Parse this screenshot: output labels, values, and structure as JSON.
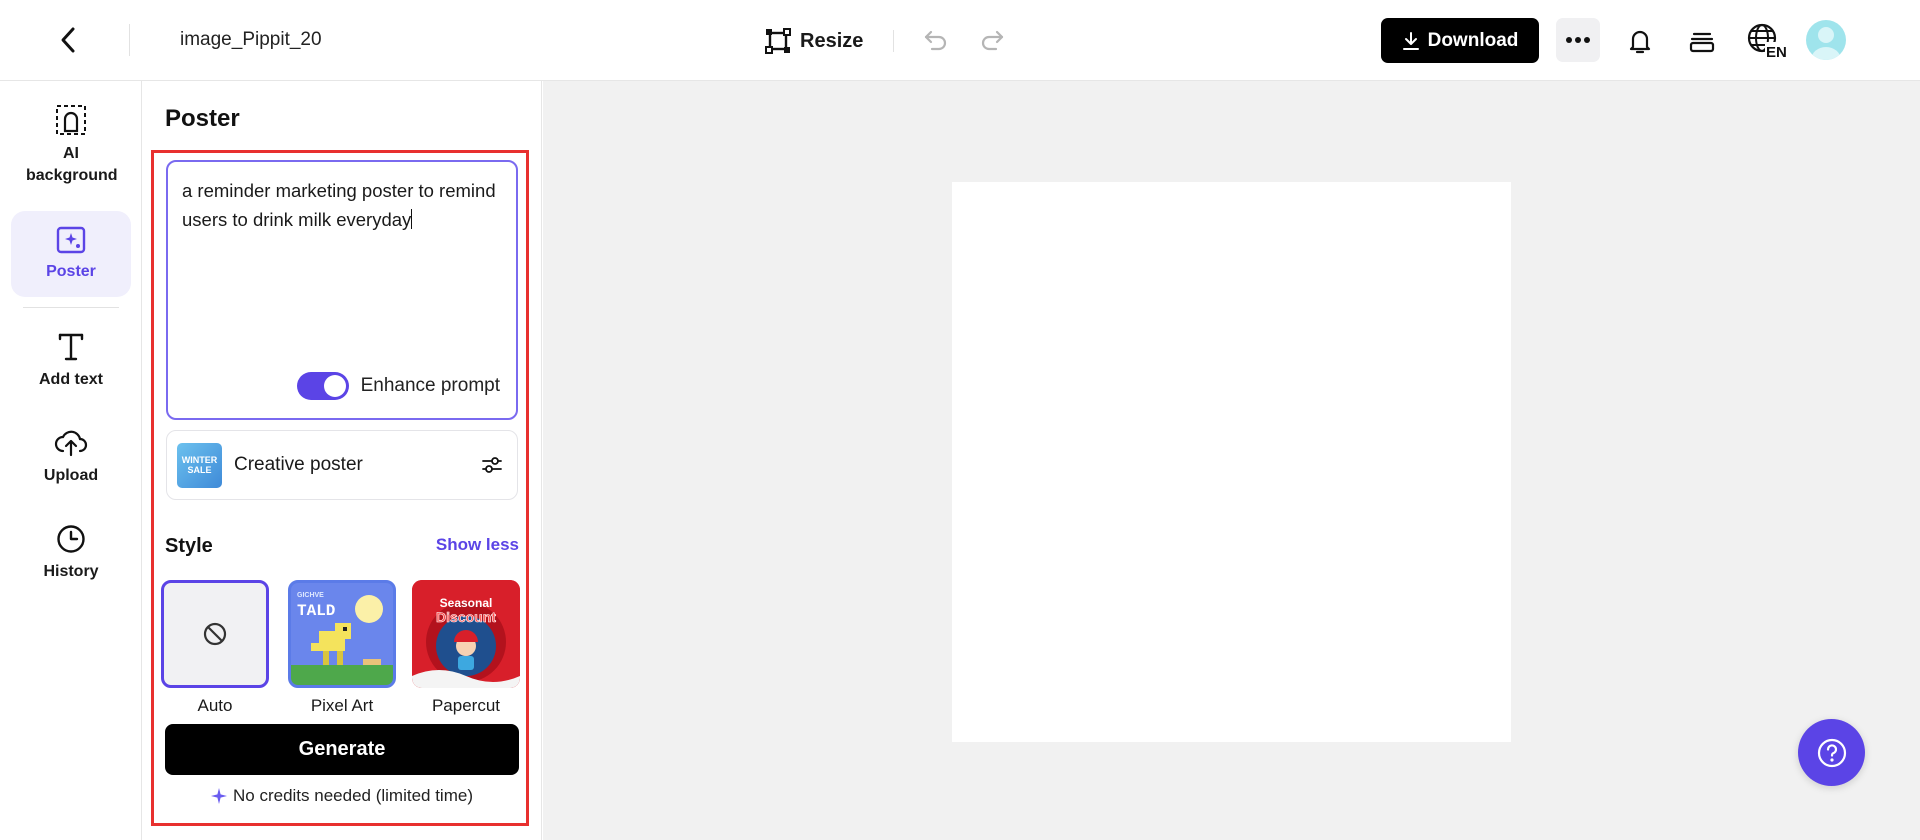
{
  "header": {
    "filename": "image_Pippit_20",
    "resize_label": "Resize",
    "download_label": "Download",
    "language_badge": "EN"
  },
  "rail": {
    "items": [
      {
        "label": "AI background",
        "icon": "ai-background-icon"
      },
      {
        "label": "Poster",
        "icon": "poster-icon",
        "active": true
      },
      {
        "label": "Add text",
        "icon": "text-icon"
      },
      {
        "label": "Upload",
        "icon": "upload-icon"
      },
      {
        "label": "History",
        "icon": "history-icon"
      }
    ]
  },
  "panel": {
    "title": "Poster",
    "prompt_value": "a reminder marketing poster to remind users to drink milk everyday",
    "enhance_label": "Enhance prompt",
    "enhance_on": true,
    "template_label": "Creative poster",
    "template_thumb_text": "WINTER SALE",
    "style_label": "Style",
    "show_less_label": "Show less",
    "styles": [
      {
        "label": "Auto",
        "selected": true
      },
      {
        "label": "Pixel Art",
        "thumb_text": "TALD",
        "thumb_small_text": "GICHVE"
      },
      {
        "label": "Papercut",
        "thumb_text": "Discount",
        "thumb_small_text": "Seasonal"
      }
    ],
    "generate_label": "Generate",
    "credits_note": "No credits needed (limited time)"
  },
  "colors": {
    "accent": "#5b44e6",
    "highlight_box": "#e8302f",
    "workspace_bg": "#f1f1f1"
  }
}
